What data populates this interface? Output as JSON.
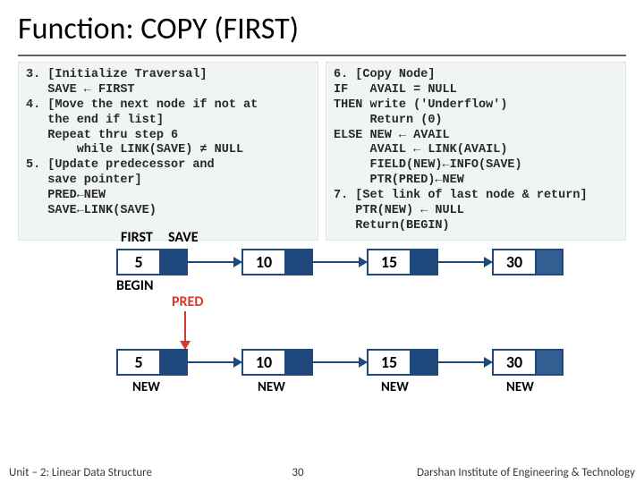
{
  "title": "Function: COPY (FIRST)",
  "code": {
    "left": "3. [Initialize Traversal]\n   SAVE ← FIRST\n4. [Move the next node if not at\n   the end if list]\n   Repeat thru step 6\n       while LINK(SAVE) ≠ NULL\n5. [Update predecessor and\n   save pointer]\n   PRED←NEW\n   SAVE←LINK(SAVE)",
    "right": "6. [Copy Node]\nIF   AVAIL = NULL\nTHEN write ('Underflow')\n     Return (0)\nELSE NEW ← AVAIL\n     AVAIL ← LINK(AVAIL)\n     FIELD(NEW)←INFO(SAVE)\n     PTR(PRED)←NEW\n7. [Set link of last node & return]\n   PTR(NEW) ← NULL\n   Return(BEGIN)"
  },
  "labels": {
    "first": "FIRST",
    "save": "SAVE",
    "begin": "BEGIN",
    "pred": "PRED",
    "new": "NEW"
  },
  "nodes": {
    "top": [
      "5",
      "10",
      "15",
      "30"
    ],
    "bottom": [
      "5",
      "10",
      "15",
      "30"
    ]
  },
  "footer": {
    "left": "Unit – 2: Linear Data Structure",
    "page": "30",
    "right": "Darshan Institute of Engineering & Technology"
  }
}
